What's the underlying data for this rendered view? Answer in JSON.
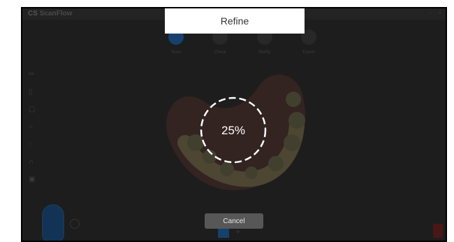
{
  "app": {
    "brand": "CS",
    "name": "ScanFlow"
  },
  "steps": [
    {
      "label": "Scan"
    },
    {
      "label": "Check"
    },
    {
      "label": "Modify"
    },
    {
      "label": "Export"
    }
  ],
  "dialog": {
    "title": "Refine",
    "progress_text": "25%",
    "progress_value": 0.25,
    "cancel_label": "Cancel"
  },
  "colors": {
    "accent": "#1f5d9c",
    "background": "#1d1d1d",
    "dialog_bg": "#ffffff",
    "cancel_bg": "#575757",
    "danger": "#6a2020"
  }
}
